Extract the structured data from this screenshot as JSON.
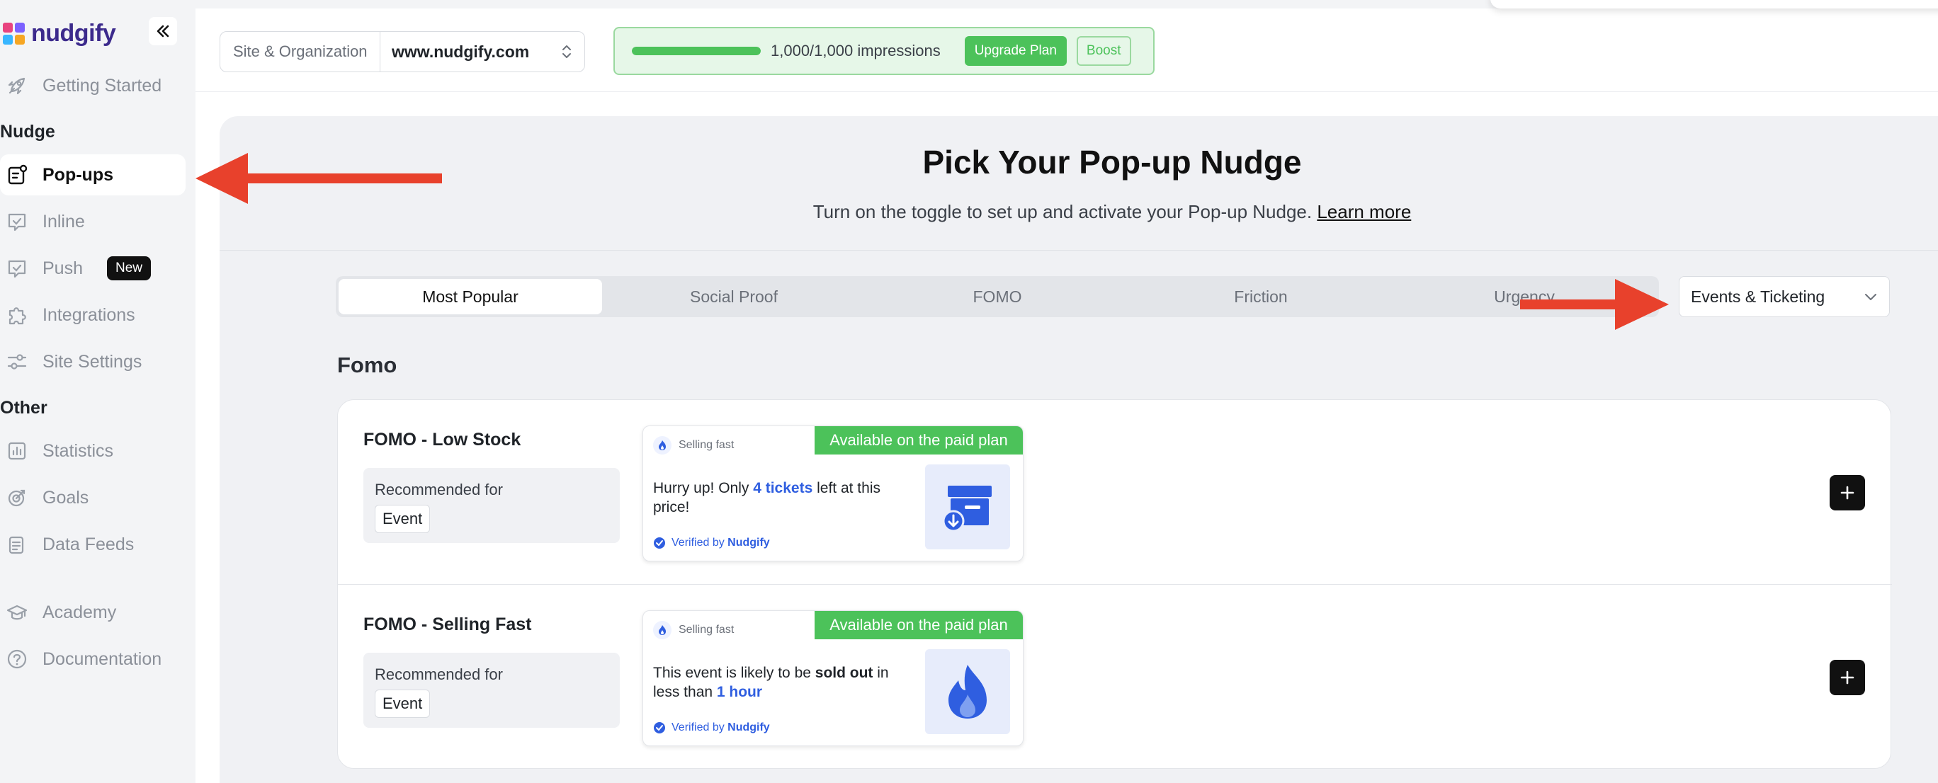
{
  "app": {
    "brand": "nudgify",
    "logo_colors": [
      "#e8437f",
      "#7b61ff",
      "#f6a623",
      "#38b6ff"
    ]
  },
  "sidebar": {
    "collapse_icon": "double-chevron-left-icon",
    "getting_started": "Getting Started",
    "section_nudge": "Nudge",
    "section_other": "Other",
    "items": [
      {
        "label": "Pop-ups",
        "icon": "popup-icon",
        "active": true
      },
      {
        "label": "Inline",
        "icon": "inline-icon"
      },
      {
        "label": "Push",
        "icon": "push-icon",
        "badge": "New"
      },
      {
        "label": "Integrations",
        "icon": "puzzle-icon"
      },
      {
        "label": "Site Settings",
        "icon": "sliders-icon"
      }
    ],
    "other_items": [
      {
        "label": "Statistics",
        "icon": "chart-icon"
      },
      {
        "label": "Goals",
        "icon": "target-icon"
      },
      {
        "label": "Data Feeds",
        "icon": "feed-icon"
      }
    ],
    "footer_items": [
      {
        "label": "Academy",
        "icon": "graduation-cap-icon"
      },
      {
        "label": "Documentation",
        "icon": "help-circle-icon"
      }
    ]
  },
  "topbar": {
    "site_label": "Site & Organization",
    "site_value": "www.nudgify.com",
    "impressions_text": "1,000/1,000 impressions",
    "impressions_fraction": 1.0,
    "upgrade_label": "Upgrade Plan",
    "boost_label": "Boost",
    "accent_green": "#4cc25a"
  },
  "hero": {
    "title": "Pick Your Pop-up Nudge",
    "subtitle": "Turn on the toggle to set up and activate your Pop-up Nudge.",
    "learn_more": "Learn more"
  },
  "tabs": [
    "Most Popular",
    "Social Proof",
    "FOMO",
    "Friction",
    "Urgency"
  ],
  "active_tab": "Most Popular",
  "category_select": "Events & Ticketing",
  "section_title": "Fomo",
  "cards": [
    {
      "title": "FOMO - Low Stock",
      "recommended_label": "Recommended for",
      "tag": "Event",
      "preview": {
        "header": "Selling fast",
        "paid_badge": "Available on the paid plan",
        "msg_a": "Hurry up! Only ",
        "msg_hl": "4 tickets",
        "msg_b": " left at this price!",
        "verified_prefix": "Verified by ",
        "verified_brand": "Nudgify",
        "image_icon": "ticket-box-icon"
      }
    },
    {
      "title": "FOMO - Selling Fast",
      "recommended_label": "Recommended for",
      "tag": "Event",
      "preview": {
        "header": "Selling fast",
        "paid_badge": "Available on the paid plan",
        "msg_a": "This event is likely to be ",
        "msg_bold": "sold out",
        "msg_b": " in less than ",
        "msg_hl": "1 hour",
        "verified_prefix": "Verified by ",
        "verified_brand": "Nudgify",
        "image_icon": "flame-icon"
      }
    }
  ],
  "annotation_color": "#e8412c"
}
